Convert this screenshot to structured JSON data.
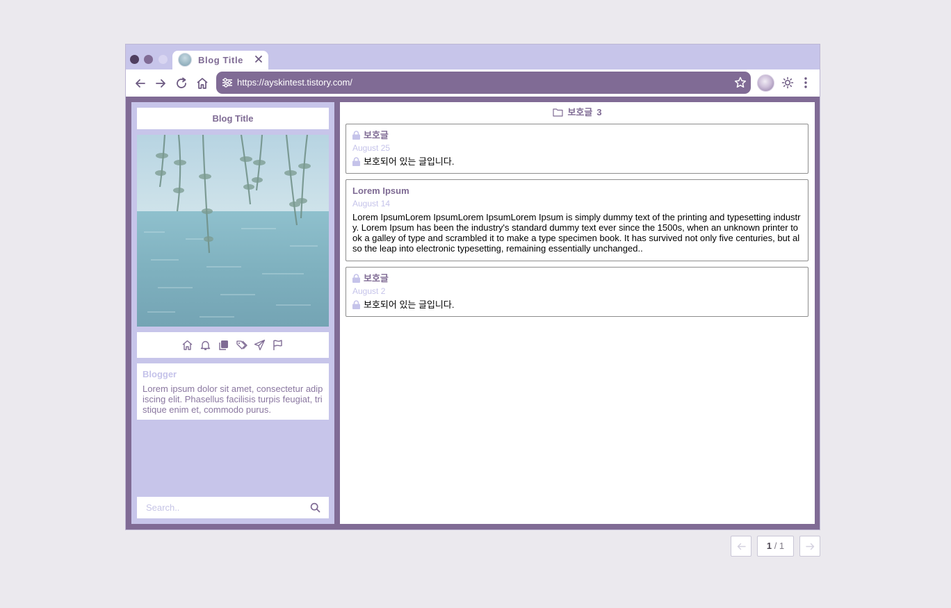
{
  "browser": {
    "tab_title": "Blog Title",
    "url": "https://ayskintest.tistory.com/"
  },
  "sidebar": {
    "blog_title": "Blog Title",
    "nav_icons": [
      "home-icon",
      "bell-icon",
      "copy-icon",
      "tags-icon",
      "send-icon",
      "flag-icon"
    ],
    "profile": {
      "name": "Blogger",
      "bio": "Lorem ipsum dolor sit amet, consectetur adipiscing elit. Phasellus facilisis turpis feugiat, tristique enim et, commodo purus."
    },
    "search": {
      "placeholder": "Search.."
    }
  },
  "category": {
    "name": "보호글",
    "count": "3"
  },
  "posts": [
    {
      "title": "보호글",
      "date": "August 25",
      "excerpt": "보호되어 있는 글입니다.",
      "protected": true
    },
    {
      "title": "Lorem Ipsum",
      "date": "August 14",
      "excerpt": "Lorem IpsumLorem IpsumLorem IpsumLorem Ipsum is simply dummy text of the printing and typesetting industry. Lorem Ipsum has been the industry's standard dummy text ever since the 1500s, when an unknown printer took a galley of type and scrambled it to make a type specimen book. It has survived not only five centuries, but also the leap into electronic typesetting, remaining essentially unchanged..",
      "protected": false
    },
    {
      "title": "보호글",
      "date": "August 2",
      "excerpt": "보호되어 있는 글입니다.",
      "protected": true
    }
  ],
  "pagination": {
    "current": "1",
    "separator": " / ",
    "total": "1"
  },
  "colors": {
    "accent": "#806b95",
    "light_accent": "#c7c5ea",
    "background": "#ebe9ee"
  }
}
